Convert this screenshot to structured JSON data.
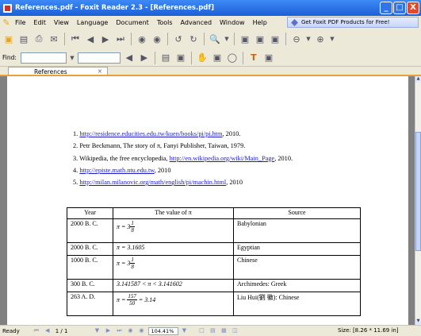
{
  "window": {
    "title": "References.pdf - Foxit Reader 2.3 - [References.pdf]",
    "minimize": "_",
    "maximize": "□",
    "close": "X"
  },
  "menu": {
    "items": [
      "File",
      "Edit",
      "View",
      "Language",
      "Document",
      "Tools",
      "Advanced",
      "Window",
      "Help"
    ],
    "promo": "Get Foxit PDF Products for Free!"
  },
  "find": {
    "label": "Find:",
    "value": ""
  },
  "tab": {
    "label": "References",
    "close": "×"
  },
  "references": [
    {
      "num": "1.",
      "pre": "",
      "link": "http://residence.educities.edu.tw/kuen/books/pi/pi.htm",
      "post": ", 2010."
    },
    {
      "num": "2.",
      "pre": "Petr Beckmann, The story of π, Fanyi Publisher, Taiwan, 1979.",
      "link": "",
      "post": ""
    },
    {
      "num": "3.",
      "pre": "Wikipedia, the free encyclopedia, ",
      "link": "http://en.wikipedia.org/wiki/Main_Page",
      "post": ", 2010."
    },
    {
      "num": "4.",
      "pre": "",
      "link": "http://episte.math.ntu.edu.tw",
      "post": ", 2010"
    },
    {
      "num": "5.",
      "pre": "",
      "link": "http://milan.milanovic.org/math/english/pi/machin.html",
      "post": ", 2010"
    }
  ],
  "table": {
    "headers": [
      "Year",
      "The value of  π",
      "Source"
    ],
    "rows": [
      {
        "year": "2000 B. C.",
        "value_lhs": "π = 3",
        "value_num": "1",
        "value_den": "8",
        "value_rhs": "",
        "source": "Babylonian"
      },
      {
        "year": "2000 B. C.",
        "value_text": "π = 3.1605",
        "source": "Egyptian"
      },
      {
        "year": "1000 B. C.",
        "value_lhs": "π = 3",
        "value_num": "1",
        "value_den": "8",
        "value_rhs": "",
        "source": "Chinese"
      },
      {
        "year": "300 B. C.",
        "value_text": "3.141587 < π < 3.141602",
        "source": "Archimedes: Greek"
      },
      {
        "year": "263 A. D.",
        "value_lhs": "π =",
        "value_num": "157",
        "value_den": "50",
        "value_rhs": "= 3.14",
        "source": "Liu Hui(劉 徽): Chinese"
      }
    ]
  },
  "status": {
    "ready": "Ready",
    "page": "1 / 1",
    "zoom": "104.41%",
    "size": "Size: [8.26 * 11.69 in]"
  }
}
